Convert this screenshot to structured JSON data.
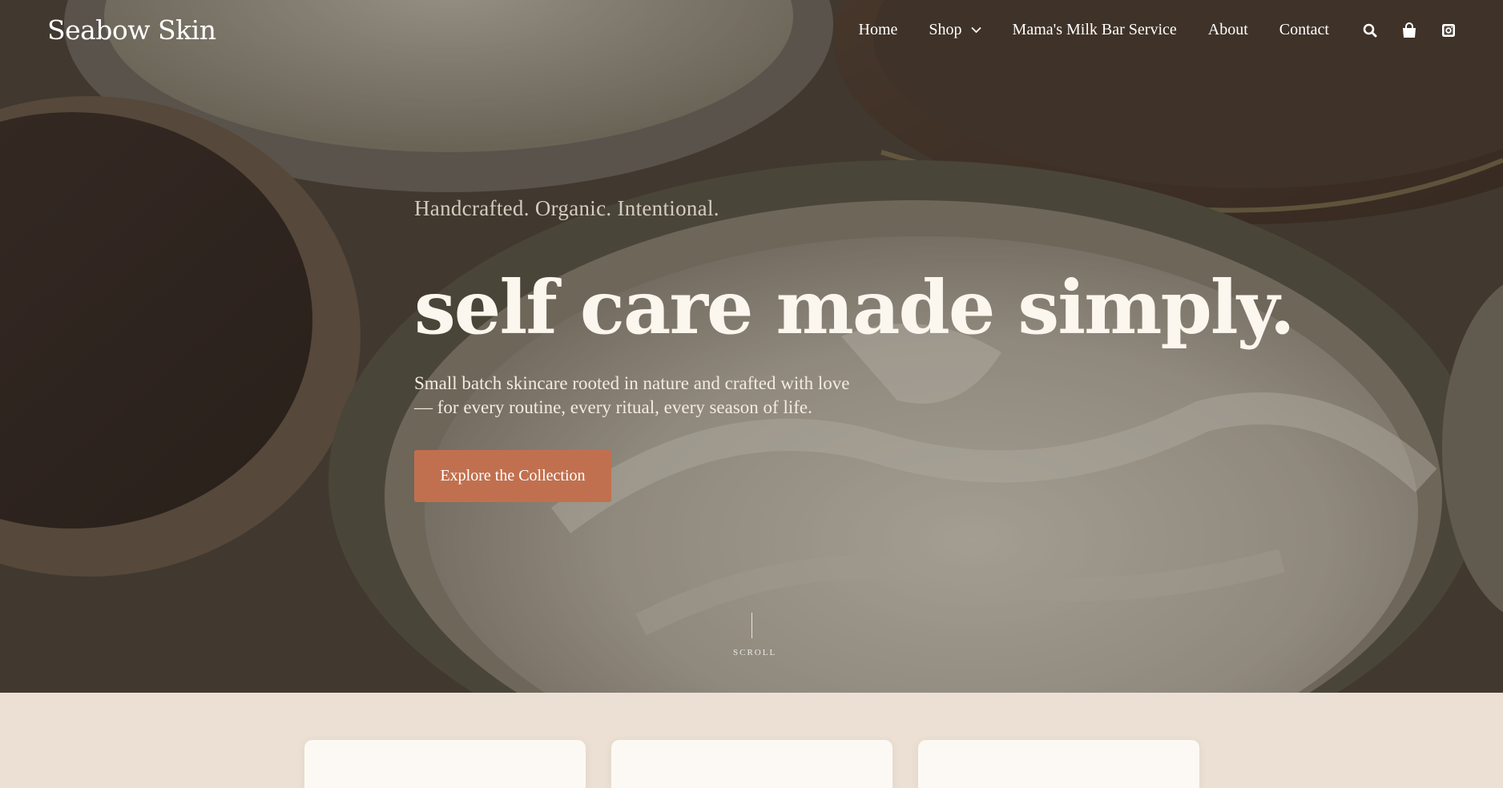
{
  "brand": {
    "name": "Seabow Skin"
  },
  "nav": {
    "items": [
      {
        "label": "Home"
      },
      {
        "label": "Shop",
        "has_dropdown": true
      },
      {
        "label": "Mama's Milk Bar Service"
      },
      {
        "label": "About"
      },
      {
        "label": "Contact"
      }
    ],
    "icons": [
      "search-icon",
      "shopping-bag-icon",
      "instagram-icon"
    ]
  },
  "hero": {
    "tagline": "Handcrafted. Organic. Intentional.",
    "headline": "self care made simply.",
    "subtext": "Small batch skincare rooted in nature and crafted with love — for every routine, every ritual, every season of life.",
    "cta_label": "Explore the Collection",
    "scroll_label": "SCROLL"
  },
  "colors": {
    "accent": "#c1704f",
    "section_bg": "#ebe0d3",
    "card_bg": "#fcf9f4"
  }
}
